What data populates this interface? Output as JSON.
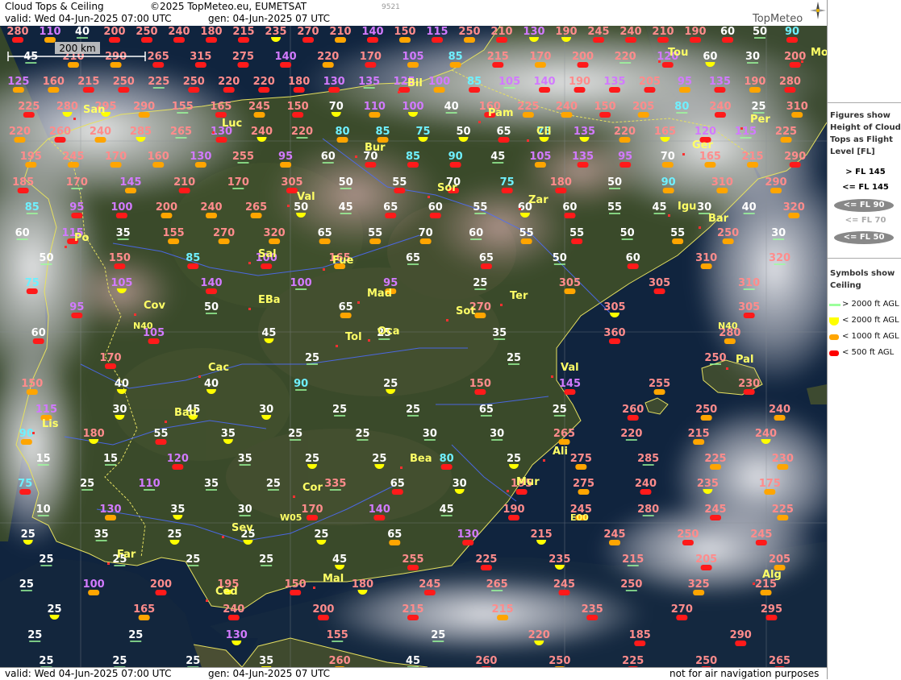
{
  "header": {
    "title": "Cloud Tops & Ceiling",
    "copyright": "©2025 TopMeteo.eu, EUMETSAT",
    "valid": "valid:  Wed  04-Jun-2025  07:00 UTC",
    "gen": "gen: 04-Jun-2025 07 UTC",
    "code": "9521",
    "logo": "TopMeteo"
  },
  "scale_bar": {
    "label": "200 km"
  },
  "footer": {
    "valid": "valid:  Wed  04-Jun-2025  07:00 UTC",
    "gen": "gen: 04-Jun-2025 07 UTC",
    "disclaimer": "not for air navigation purposes"
  },
  "legend": {
    "figures_title": "Figures show Height of Cloud Tops as Flight Level  [FL]",
    "tops": [
      {
        "label": "> FL 145",
        "color": "#ff8080"
      },
      {
        "label": "<= FL 145",
        "color": "#cc66ff"
      },
      {
        "label": "<= FL 90",
        "color": "#66ffff"
      },
      {
        "label": "<= FL 70",
        "color": "#ffffff"
      },
      {
        "label": "<= FL 50",
        "color": "#ffffff"
      }
    ],
    "symbols_title": "Symbols show Ceiling",
    "ceiling": [
      {
        "label": "> 2000 ft AGL",
        "color": "#9cff9c"
      },
      {
        "label": "< 2000 ft AGL",
        "color": "#ffff00"
      },
      {
        "label": "< 1000 ft AGL",
        "color": "#ffa500"
      },
      {
        "label": "< 500 ft AGL",
        "color": "#ff0000"
      }
    ]
  },
  "cities": [
    "Bil",
    "San",
    "Luc",
    "Pam",
    "Cil",
    "Per",
    "Tou",
    "Mon",
    "Ger",
    "Bur",
    "Val",
    "Sor",
    "Zar",
    "Igu",
    "Bar",
    "Sal",
    "Fue",
    "Po",
    "Mad",
    "EBa",
    "Cov",
    "Sot",
    "Ter",
    "Tol",
    "Oca",
    "Cac",
    "Val",
    "Bad",
    "Pal",
    "Lis",
    "Bea",
    "Ali",
    "Cor",
    "Mur",
    "Sev",
    "Far",
    "Mal",
    "Alg",
    "Ced"
  ],
  "markers": [
    "N40",
    "N40",
    "W05",
    "E00"
  ],
  "labels_rows": [
    [
      "280",
      "110",
      "40",
      "200",
      "250",
      "240",
      "180",
      "215",
      "235",
      "270",
      "210",
      "140",
      "150",
      "115",
      "250",
      "210",
      "130",
      "190",
      "245",
      "240",
      "210",
      "190",
      "60",
      "50",
      "90"
    ],
    [
      "45",
      "210",
      "290",
      "265",
      "315",
      "275",
      "140",
      "220",
      "170",
      "105",
      "85",
      "215",
      "170",
      "200",
      "220",
      "120",
      "60",
      "30",
      "200"
    ],
    [
      "125",
      "160",
      "215",
      "250",
      "225",
      "250",
      "220",
      "220",
      "180",
      "130",
      "135",
      "125",
      "100",
      "85",
      "105",
      "140",
      "190",
      "135",
      "205",
      "95",
      "135",
      "190",
      "280"
    ],
    [
      "225",
      "280",
      "295",
      "290",
      "155",
      "165",
      "245",
      "150",
      "70",
      "110",
      "100",
      "40",
      "160",
      "225",
      "240",
      "150",
      "205",
      "80",
      "240",
      "25",
      "310"
    ],
    [
      "220",
      "260",
      "240",
      "285",
      "265",
      "130",
      "240",
      "220",
      "80",
      "85",
      "75",
      "50",
      "65",
      "75",
      "135",
      "220",
      "165",
      "120",
      "115",
      "225"
    ],
    [
      "195",
      "245",
      "170",
      "160",
      "130",
      "255",
      "95",
      "60",
      "70",
      "85",
      "90",
      "45",
      "105",
      "135",
      "95",
      "70",
      "165",
      "215",
      "290"
    ],
    [
      "185",
      "170",
      "145",
      "210",
      "170",
      "305",
      "50",
      "55",
      "70",
      "75",
      "180",
      "50",
      "90",
      "310",
      "290"
    ],
    [
      "85",
      "95",
      "100",
      "200",
      "240",
      "265",
      "50",
      "45",
      "65",
      "60",
      "55",
      "60",
      "60",
      "55",
      "45",
      "30",
      "40",
      "320"
    ],
    [
      "60",
      "115",
      "35",
      "155",
      "270",
      "320",
      "65",
      "55",
      "70",
      "60",
      "55",
      "55",
      "50",
      "55",
      "250",
      "30"
    ],
    [
      "50",
      "150",
      "85",
      "100",
      "165",
      "65",
      "65",
      "50",
      "60",
      "310",
      "320"
    ],
    [
      "75",
      "105",
      "140",
      "100",
      "95",
      "25",
      "305",
      "305",
      "310"
    ],
    [
      "95",
      "50",
      "65",
      "270",
      "305",
      "305"
    ],
    [
      "60",
      "105",
      "45",
      "25",
      "35",
      "360",
      "280"
    ],
    [
      "170",
      "25",
      "25",
      "250"
    ],
    [
      "150",
      "40",
      "40",
      "90",
      "25",
      "150",
      "145",
      "255",
      "230"
    ],
    [
      "115",
      "30",
      "45",
      "30",
      "25",
      "25",
      "65",
      "25",
      "260",
      "250",
      "240"
    ],
    [
      "90",
      "180",
      "55",
      "35",
      "25",
      "25",
      "30",
      "30",
      "265",
      "220",
      "215",
      "240"
    ],
    [
      "15",
      "15",
      "120",
      "35",
      "25",
      "25",
      "80",
      "25",
      "275",
      "285",
      "225",
      "230"
    ],
    [
      "75",
      "25",
      "110",
      "35",
      "25",
      "335",
      "65",
      "30",
      "195",
      "275",
      "240",
      "235",
      "175"
    ],
    [
      "10",
      "130",
      "35",
      "30",
      "170",
      "140",
      "45",
      "190",
      "245",
      "280",
      "245",
      "225"
    ],
    [
      "25",
      "35",
      "25",
      "25",
      "25",
      "65",
      "130",
      "215",
      "245",
      "250",
      "245"
    ],
    [
      "25",
      "25",
      "25",
      "25",
      "45",
      "255",
      "225",
      "235",
      "215",
      "205",
      "205"
    ],
    [
      "25",
      "100",
      "200",
      "195",
      "150",
      "180",
      "245",
      "265",
      "245",
      "250",
      "325",
      "215"
    ],
    [
      "25",
      "165",
      "240",
      "200",
      "215",
      "215",
      "235",
      "270",
      "295"
    ],
    [
      "25",
      "25",
      "130",
      "155",
      "25",
      "220",
      "185",
      "290"
    ],
    [
      "25",
      "25",
      "25",
      "35",
      "260",
      "45",
      "260",
      "250",
      "225",
      "250",
      "265"
    ]
  ]
}
